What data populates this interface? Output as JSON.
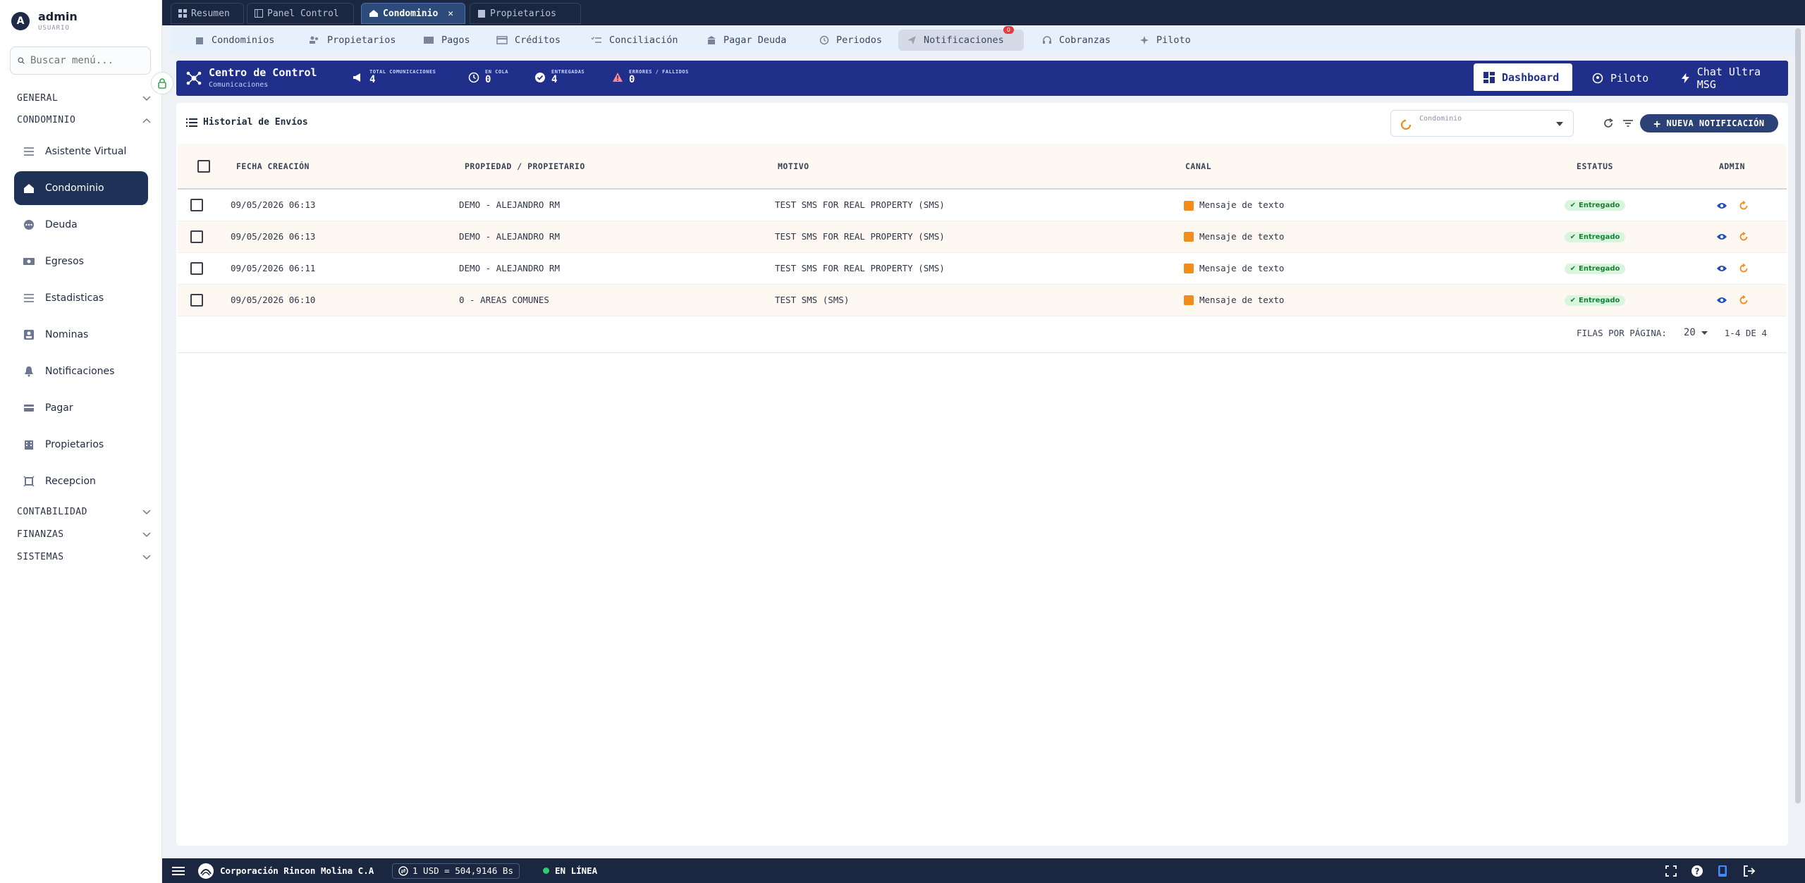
{
  "user": {
    "initial": "A",
    "name": "admin",
    "role": "USUARIO"
  },
  "search": {
    "placeholder": "Buscar menú..."
  },
  "sidebar": {
    "sections": [
      {
        "label": "GENERAL"
      },
      {
        "label": "CONDOMINIO"
      },
      {
        "label": "CONTABILIDAD"
      },
      {
        "label": "FINANZAS"
      },
      {
        "label": "SISTEMAS"
      }
    ],
    "items": [
      {
        "label": "Asistente Virtual"
      },
      {
        "label": "Condominio"
      },
      {
        "label": "Deuda"
      },
      {
        "label": "Egresos"
      },
      {
        "label": "Estadisticas"
      },
      {
        "label": "Nominas"
      },
      {
        "label": "Notificaciones"
      },
      {
        "label": "Pagar"
      },
      {
        "label": "Propietarios"
      },
      {
        "label": "Recepcion"
      }
    ]
  },
  "window_tabs": [
    {
      "label": "Resumen"
    },
    {
      "label": "Panel Control"
    },
    {
      "label": "Condominio"
    },
    {
      "label": "Propietarios"
    }
  ],
  "module_tabs": [
    {
      "label": "Condominios"
    },
    {
      "label": "Propietarios"
    },
    {
      "label": "Pagos"
    },
    {
      "label": "Créditos"
    },
    {
      "label": "Conciliación"
    },
    {
      "label": "Pagar Deuda"
    },
    {
      "label": "Periodos"
    },
    {
      "label": "Notificaciones",
      "badge": "0"
    },
    {
      "label": "Cobranzas"
    },
    {
      "label": "Piloto"
    }
  ],
  "control": {
    "title": "Centro de Control",
    "subtitle": "Comunicaciones",
    "stats": [
      {
        "label": "TOTAL COMUNICACIONES",
        "value": "4"
      },
      {
        "label": "EN COLA",
        "value": "0"
      },
      {
        "label": "ENTREGADAS",
        "value": "4"
      },
      {
        "label": "ERRORES / FALLIDOS",
        "value": "0"
      }
    ],
    "buttons": [
      {
        "label": "Dashboard"
      },
      {
        "label": "Piloto"
      },
      {
        "label": "Chat Ultra MSG"
      }
    ]
  },
  "history": {
    "title": "Historial de Envíos",
    "select_label": "Condominio",
    "new_button": "NUEVA NOTIFICACIÓN",
    "columns": [
      "FECHA CREACIÓN",
      "PROPIEDAD / PROPIETARIO",
      "MOTIVO",
      "CANAL",
      "ESTATUS",
      "ADMIN"
    ],
    "rows": [
      {
        "fecha": "09/05/2026 06:13",
        "propiedad": "DEMO - ALEJANDRO RM",
        "motivo": "TEST SMS FOR REAL PROPERTY (SMS)",
        "canal": "Mensaje de texto",
        "estatus": "Entregado"
      },
      {
        "fecha": "09/05/2026 06:13",
        "propiedad": "DEMO - ALEJANDRO RM",
        "motivo": "TEST SMS FOR REAL PROPERTY (SMS)",
        "canal": "Mensaje de texto",
        "estatus": "Entregado"
      },
      {
        "fecha": "09/05/2026 06:11",
        "propiedad": "DEMO - ALEJANDRO RM",
        "motivo": "TEST SMS FOR REAL PROPERTY (SMS)",
        "canal": "Mensaje de texto",
        "estatus": "Entregado"
      },
      {
        "fecha": "09/05/2026 06:10",
        "propiedad": "0 - AREAS COMUNES",
        "motivo": "TEST SMS (SMS)",
        "canal": "Mensaje de texto",
        "estatus": "Entregado"
      }
    ],
    "pager": {
      "rows_label": "FILAS POR PÁGINA:",
      "rows_value": "20",
      "range": "1-4 DE 4"
    }
  },
  "bottom": {
    "company": "Corporación Rincon Molina C.A",
    "rate": "1 USD = 504,9146 Bs",
    "status": "EN LÍNEA"
  },
  "colors": {
    "brand": "#1f2f8a",
    "sidebar_active": "#1e3257",
    "status_ok": "#1a7f37",
    "channel": "#f28c1a"
  }
}
